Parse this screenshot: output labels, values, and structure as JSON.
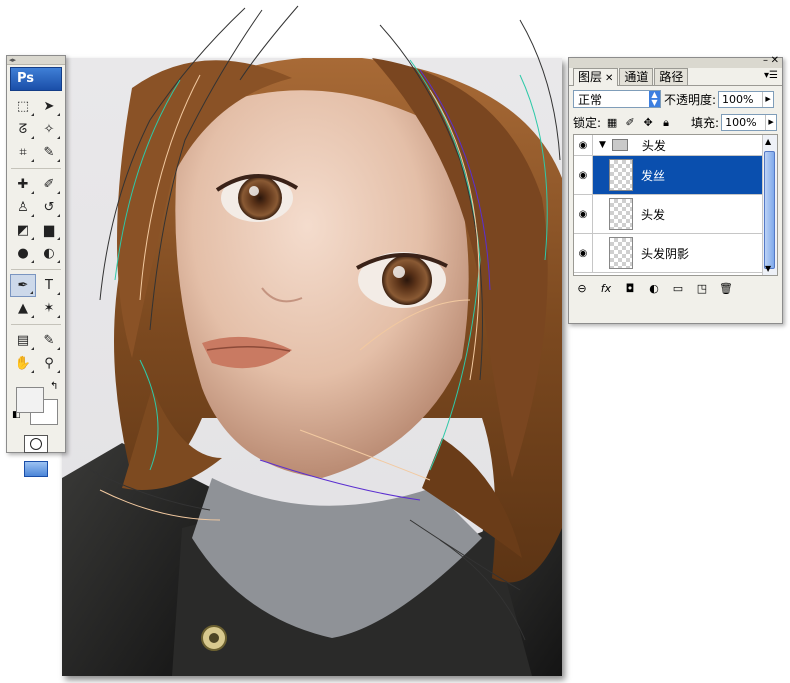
{
  "tools_palette": {
    "logo": "Ps",
    "tools": [
      {
        "name": "marquee-tool",
        "glyph": "⬚"
      },
      {
        "name": "move-tool",
        "glyph": "➤"
      },
      {
        "name": "lasso-tool",
        "glyph": "ᘔ"
      },
      {
        "name": "magic-wand-tool",
        "glyph": "✧"
      },
      {
        "name": "crop-tool",
        "glyph": "⌗"
      },
      {
        "name": "eyedropper-tool",
        "glyph": "✎"
      },
      {
        "name": "healing-brush-tool",
        "glyph": "✚"
      },
      {
        "name": "brush-tool",
        "glyph": "✐"
      },
      {
        "name": "clone-stamp-tool",
        "glyph": "♙"
      },
      {
        "name": "history-brush-tool",
        "glyph": "↺"
      },
      {
        "name": "eraser-tool",
        "glyph": "◩"
      },
      {
        "name": "gradient-tool",
        "glyph": "▆"
      },
      {
        "name": "blur-tool",
        "glyph": "●"
      },
      {
        "name": "dodge-tool",
        "glyph": "◐"
      },
      {
        "name": "pen-tool",
        "glyph": "✒"
      },
      {
        "name": "type-tool",
        "glyph": "T"
      },
      {
        "name": "path-selection-tool",
        "glyph": "▲"
      },
      {
        "name": "custom-shape-tool",
        "glyph": "✶"
      },
      {
        "name": "notes-tool",
        "glyph": "▤"
      },
      {
        "name": "measure-eyedropper-tool",
        "glyph": "✎"
      },
      {
        "name": "hand-tool",
        "glyph": "✋"
      },
      {
        "name": "zoom-tool",
        "glyph": "⚲"
      }
    ]
  },
  "layers_panel": {
    "tabs": [
      "图层",
      "通道",
      "路径"
    ],
    "active_tab": "图层",
    "blend_mode": "正常",
    "opacity_label": "不透明度:",
    "opacity_value": "100%",
    "lock_label": "锁定:",
    "fill_label": "填充:",
    "fill_value": "100%",
    "group": {
      "name": "头发"
    },
    "layers": [
      {
        "name": "发丝",
        "selected": true
      },
      {
        "name": "头发",
        "selected": false
      },
      {
        "name": "头发阴影",
        "selected": false
      }
    ]
  },
  "colors": {
    "selection_blue": "#0a4fae",
    "hair_brown": "#8a5226",
    "path_cyan": "#2ec9a8",
    "path_purple": "#5b2fd0"
  }
}
